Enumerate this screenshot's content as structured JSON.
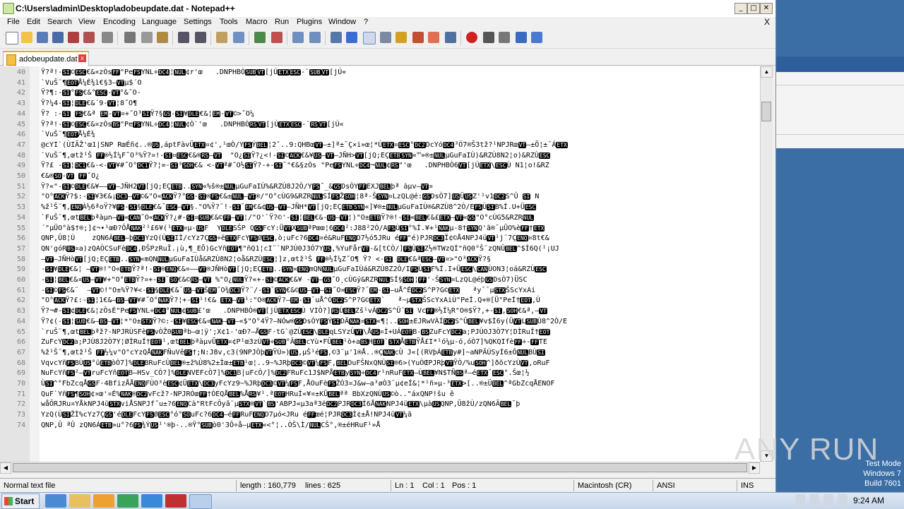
{
  "window": {
    "title": "C:\\Users\\admin\\Desktop\\adobeupdate.dat - Notepad++",
    "min": "_",
    "max": "□",
    "close": "✕"
  },
  "menu": {
    "items": [
      "File",
      "Edit",
      "Search",
      "View",
      "Encoding",
      "Language",
      "Settings",
      "Tools",
      "Macro",
      "Run",
      "Plugins",
      "Window",
      "?"
    ],
    "close_x": "X"
  },
  "tab": {
    "label": "adobeupdate.dat",
    "close": "x"
  },
  "editor": {
    "lines": [
      {
        "n": "40",
        "t": "Ÿ?ª!-SI©ESC€&¤zÒsFF\"PeFSYNL÷DC4¦NUL¢r'œ   .DNPHBÒSUBVT[jÚETXESC-`SUBVT[jÚ«"
      },
      {
        "n": "41",
        "t": "`VuŠ¨¶EOTÅ¼É¾ì€§3—VTµ$´O"
      },
      {
        "n": "42",
        "t": "Ÿ?¶:-SI°FS€&°ESC-VT°&˝O-"
      },
      {
        "n": "43",
        "t": "Ÿ?¼4-SI¦DLE€&´9-VT¦8˝O¶"
      },
      {
        "n": "44",
        "t": "Ÿ? :-SI FS€&ª EM-VT¤+˝O³SIŸ?§GS-SI¥DLE€&¦EM-VT©>˝O¼"
      },
      {
        "n": "45",
        "t": "Ÿ?ª!-SI©ESC€&¤zÒsBS\"PeFSYNL÷DC4¦NUL¢Ò`'œ   .DNPHBÒRSVT[jÚETXESC-`RSVT[jÚ«"
      },
      {
        "n": "46",
        "t": "`VuŠ¨¶EOTÅ¼É¾"
      },
      {
        "n": "47",
        "t": "@cYI`(ÙIÄŽ'œ1|SNP RœÉñ¢..®US,áptFàvÜETX¤¢',¹œÒ/YFSÝBEL¦2ˇ..9:QHBœVT—±]ª±¯Ç×i»œ¦*ÚETX¤ESC°DC2DcYóDC4³Ó7®Š3tž?¹NPJRœVT—±Ö¦±¯ÁETX"
      },
      {
        "n": "48",
        "t": "`VuŠ¨¶,œtž¹Š FF®½Í¼F˝O³%Ÿ?¤!-SI¤ESC€&®RS—VT  \"O¿SIŸ?¿<!-SI©ACK€&¥US—VT—JÑH>VT[jQ;EÇETBSYN«™»®±NULµGuFaIÙ)&RZÙ8N2¦o)&RZÙESC"
      },
      {
        "n": "49",
        "t": "Ÿ?£ -SI¦DC1€&-<-VT¥#˝O°DC1Ÿ?¦=-SI³SOH€& <-VTª#˝O½SIŸ?-+-SI¯\"€&§zÒs \"PeFSYNL÷DC4¬NUL¢RS\"'œ   .DNPHBÒ6VT[jÚETX\\ESCÙ N1¦o!&RZ"
      },
      {
        "n": "50",
        "t": "€&®SO-VT FF˝O¿"
      },
      {
        "n": "51",
        "t": "Ÿ?«\"-SI©DLE€&¥——VT—JÑH2VT[jQ;EÇETB..SYN«%š®±NULµGuFaIÙ%&RZÙ8J2Ò/YFS¯_&GSDsÒYFFEXJBELþª àµv—VT¤"
      },
      {
        "n": "52",
        "t": "\"O°ACKŸ?$:-SI¥3€&¡DC3—VT©&\"O«ACKŸ?°GS-SI®FS€&±NUL—VT®/\"O°cÙG9&RZRNULSÍFSŽSOH¦8ª-ŠSYN¤LzQL@é:GSDsÒ7]USÜUSZ'¹v1DC2S^Û SI N"
      },
      {
        "n": "53",
        "t": "%ž¹Š¨¶,ENQÀ½6ªoŸ?¥FS-SI§DLE€&¯ESC—VT§.\"O%Ÿ?¨!-SI¯EM€&¢US—VT—JÑH*VT[jQ;EÇETBSYN«]¥®±NULµGuFaIÙ®&RZÙ8^2Ò/EFSÙSIB%Í.U+ÜESC"
      },
      {
        "n": "54",
        "t": "`FuŠ¨¶,œtBELþªàµn—VT«CAN˝O«ACKŸ?¿#-SI¤SUB€&©FF—VT¦/\"O'`Ÿ?©'-SI¦BEL€&-US—VT¦)\"O±ETBŸ?®!-SI«BEL€&£ETX—VT«GS\"O°cÙG5&RZRNUL"
      },
      {
        "n": "55",
        "t": "´\"µÜO°à$†®;]¢¬•¹œÐ?ÔÅNAK²¹£6¥(¹ETX¤µ-USF  YDLESŠP QGSFcY:ÜVTXSUBªPœœ¦6DC4²:J88²2Ò/AFSÙSI°%Í.¥+¹NAKµ-8†SYNQ'ã®¯µÜO%èFF†ETX"
      },
      {
        "n": "56",
        "t": "QNP,Û8¦Ù    zQN6ÀBEL—þDC1YzQ(ÙSIIÌ/cYz7ÇGS÷ëETXFcYFSØESC,ò;uFc?6DC4¤é&RuFENQD7½ó5JRu éFF\"é)PJRDC3Ï¢©Å4NPJ4üVT¹j¨7ÇENQ¤8t€&"
      },
      {
        "n": "57",
        "t": "QN'góRBS¤a)zQAÒCSuFèDC4,ÐŠPzRuÏ.¡ù,¶_EÕ)GcYñEOT¶\"ñQ1¦cI¨`NPJÙ0J3Ò7YUS,%YuFårVT-&[tCÒ/]FSÙSIZ½®TWzQÍ\"ñQ0°Š¨zQNÛBEL^$Í6Q(¹¡UJ"
      },
      {
        "n": "58",
        "t": "—VT—JÑHòVT[jQ;EÇETB..SYN«mQNNULµGuFaIÙå&RZÙ8N2¦oå&RZÙESC¦]z,œtž¹Š FF®½Í¼Z˝O¶ Ÿ? <-SI DLE€&ªESC—VT¤>\"O³ACKŸ?§"
      },
      {
        "n": "59",
        "t": "-SI¥DLE€&¦ —VT®!\"O«ETBŸ?ª!-SI®ENQ€&¤——VT®JÑHòVT[jQ;EÇETB..SYN«ENQmQNNULµGuFaIÙá&RZÙ8Z2Ò/IFSÙSIF%Í.I+ÜESC\\CANÙON3¦oá&RZÙESC"
      },
      {
        "n": "60",
        "t": "-SI¦BEL€&¤US—VT¥+\"O°ETBŸ?¤+-SI¯SO€&©RS—VT %\"O¿NULŸ?«+-SI©ACK€&¥ -VT—GS˝O¸cÙGý&RZRNULSÍ§SOH¦FF'-ŠSYN¤LzQL@éþGSDsÒ7)ÜSC"
      },
      {
        "n": "61",
        "t": "-SI©FS€&¨  —VT©!\"O±%Ÿ?¥<-SI§DLE€&¯US—VTŠEM˝O¾DC3Ÿ?¨/-SI¯SYN€&©US—VT—SI˝O»ESCŸ?¯EM-SI—uÅ^ÉDC2S^P?G©ETX   ªy¯¯µSTXŠScYxAi"
      },
      {
        "n": "62",
        "t": "\"O°ACKŸ?£:-SI¦1€&—BS—VT¥#˝O°NAKŸ?¦+-SI¹!€& ETX—VT¹:\"O®ACKŸ?—EM-SI¯uÅ^ÒDC2S^P?G©ETX`   ª~µSTXŠScYxAiÙ\"PeÍ.Q+®[Ü\"PeÍ†EOT,Ù"
      },
      {
        "n": "63",
        "t": "Ÿ?¬#-SI¢DLE€&¦zÒsÈ\"PeFSYNL÷DC4°NUL¢SUB£'œ   .DNPHBÒ®VT[jÚETXESCÙ VIÒ?]RSÙBELZš¹vÁDC2S^Û¨SI VcFF®½Í¼R\"O®$Ÿ?,+-SI,SOH€&ª,—VT"
      },
      {
        "n": "64",
        "t": "Ÿ?¢(-SI¦SUB€&—BS—VT¦*\"O±STXŸ?©:-SI¥ESC€&¤NAK—VT—«$\"O°4Ÿ?—NÓw®GSDsÒYFSÝSIDÃNAK¤STX«¶¦..SOH±EJRwVÀÍDC2S^ÛBEL¥v$Í6y(ÜVTLSUBÙ8^2Ò/E"
      },
      {
        "n": "65",
        "t": "`ruŠ¨¶,œtBELþªž?-NPJRÙSFèFSvÒŽ0SUBªb—œ¦ÿ';X¢1-'œÐ?—ÅGSF·tG`@ZÙESC\\DLEqLSYzÙVT\\ÅUS¤Ì+UÁEOTB-BSZuFcYDC2a;PJÙOJ3Ò7Y¦DÌRuÍ†EOT"
      },
      {
        "n": "66",
        "t": "ZuFcYDC2a;PJÙ8J2Ò7Y¦ØÌRuÍ†EOT¹,œtBELþªàµvÜETX¤¢P¹œ3zÙVT÷SUB°ÄBELcYù•FÛBEL¹ò+aBSHEOT`STXÅETBŸÅ£I*¹ó¼µ-ó,óÒ7]%QKQIfèFF÷-FFTE"
      },
      {
        "n": "67",
        "t": "%ž¹Š¨¶,œtž¹Š FF½¼v\"O\"cYzQÅNAKFÑuVêFS†;N:J8v,c3(9NPJÒþVTŸÙ»)US,µŠ¹éFS,©3¨µ'1®Å..®ÇNAKcÙ J«[(RVþÁETBy#]~aNPÄÙSyÍ6±ÔNULBÙSI"
      },
      {
        "n": "68",
        "t": "VqvcYñFSBÙUS°üETBòÒ7]%DLEBRuFcÙBEL®±ž%Ù8%2±Ìœ±ETB¹œ¦..9~%JRþDC3©VT¼FSF,BELDuFŠNxQNÙSI®6>(YuÒŒPJRþVTŸÒ/%uSOH^]ðõcYzÙVT,oRuF"
      },
      {
        "n": "69",
        "t": "NuFcYñFS²—VTruFcYñEOTB—HSv_CÒ?]%DLENVEFcÒ7]%DC1B|uFcÒ/]%DC2FRuFc1J$NPÅETBySYN÷DC4r¹nRuFETX—ÙBEL¥N$TÑBSª—éETX¯ESC°.Šœ¦½"
      },
      {
        "n": "70",
        "t": "ÙSI^°FbZcqÅGSF·4BfizÅÅENQFÙO³èESC¢ÜETX\\DC3yFcYz9~%JRþDC3©VT¼FSF,ÅOuFèFSŽÒ3¤J&w—a³øÒ3¨µ¢eÍ&¦*¹ñ»µ-³ETX>[..®±ÜBEL^ªGbZcqÅENOF"
      },
      {
        "n": "71",
        "t": "QuF`YñFS¶SOH¢¤œ'¤É%NAK®DC2vFcž?-NPJRÒœFF†ÒEQÅBEL%ÅRS¥¹.ªEOTHRuÍ«¥¤±KÜBELªª BbXzQNÙUS©ò..\"áxQNP!šu ê"
      },
      {
        "n": "72",
        "t": "wåÔRJRu¤YÅkNPJ4üSTXviÅSNPJf˝u±?6ENQCà\"RtFcÔyâ¨µSTX®VT`BS'ABPJ«µ3aª3ëDC2PJRDC3Ì6ÅNAKNPJ4üETX\\µàUSQNP,Û8žÙ/zQN6ÄBEL¯þ"
      },
      {
        "n": "73",
        "t": "YzQ(ÙSIŽÌ%cYz7ÇGS'éDLEFcYFSØESC°ó°SOuFc?6DC4—éFFRuFENQD7µó<JRu éFFœé¦PJRDC3Ì¢±Å!NPJ4üVT¼ã"
      },
      {
        "n": "74",
        "t": "QNP,Û ªÛ zQN6ÁETB»u°?6FS¾ÝUS¹'®þ-..®Ÿ°SUBò0'3Ô÷å—µETX«<°¦..ÒŠ\\Ì/NULCŠ°,®±éHRuF¹»Å"
      }
    ]
  },
  "statusbar": {
    "type": "Normal text file",
    "length": "length : 160,779",
    "lines": "lines : 625",
    "ln": "Ln : 1",
    "col": "Col : 1",
    "pos": "Pos : 1",
    "eol": "Macintosh (CR)",
    "encoding": "ANSI",
    "ins": "INS"
  },
  "desktop": {
    "watermark": "ANY RUN",
    "test_mode_line1": "Test Mode",
    "test_mode_line2": "Windows 7",
    "test_mode_line3": "Build 7601"
  },
  "taskbar": {
    "start_label": "Start",
    "clock": "9:24 AM"
  },
  "colors": {
    "accent": "#f5a623",
    "desktop": "#3a6ea5"
  }
}
